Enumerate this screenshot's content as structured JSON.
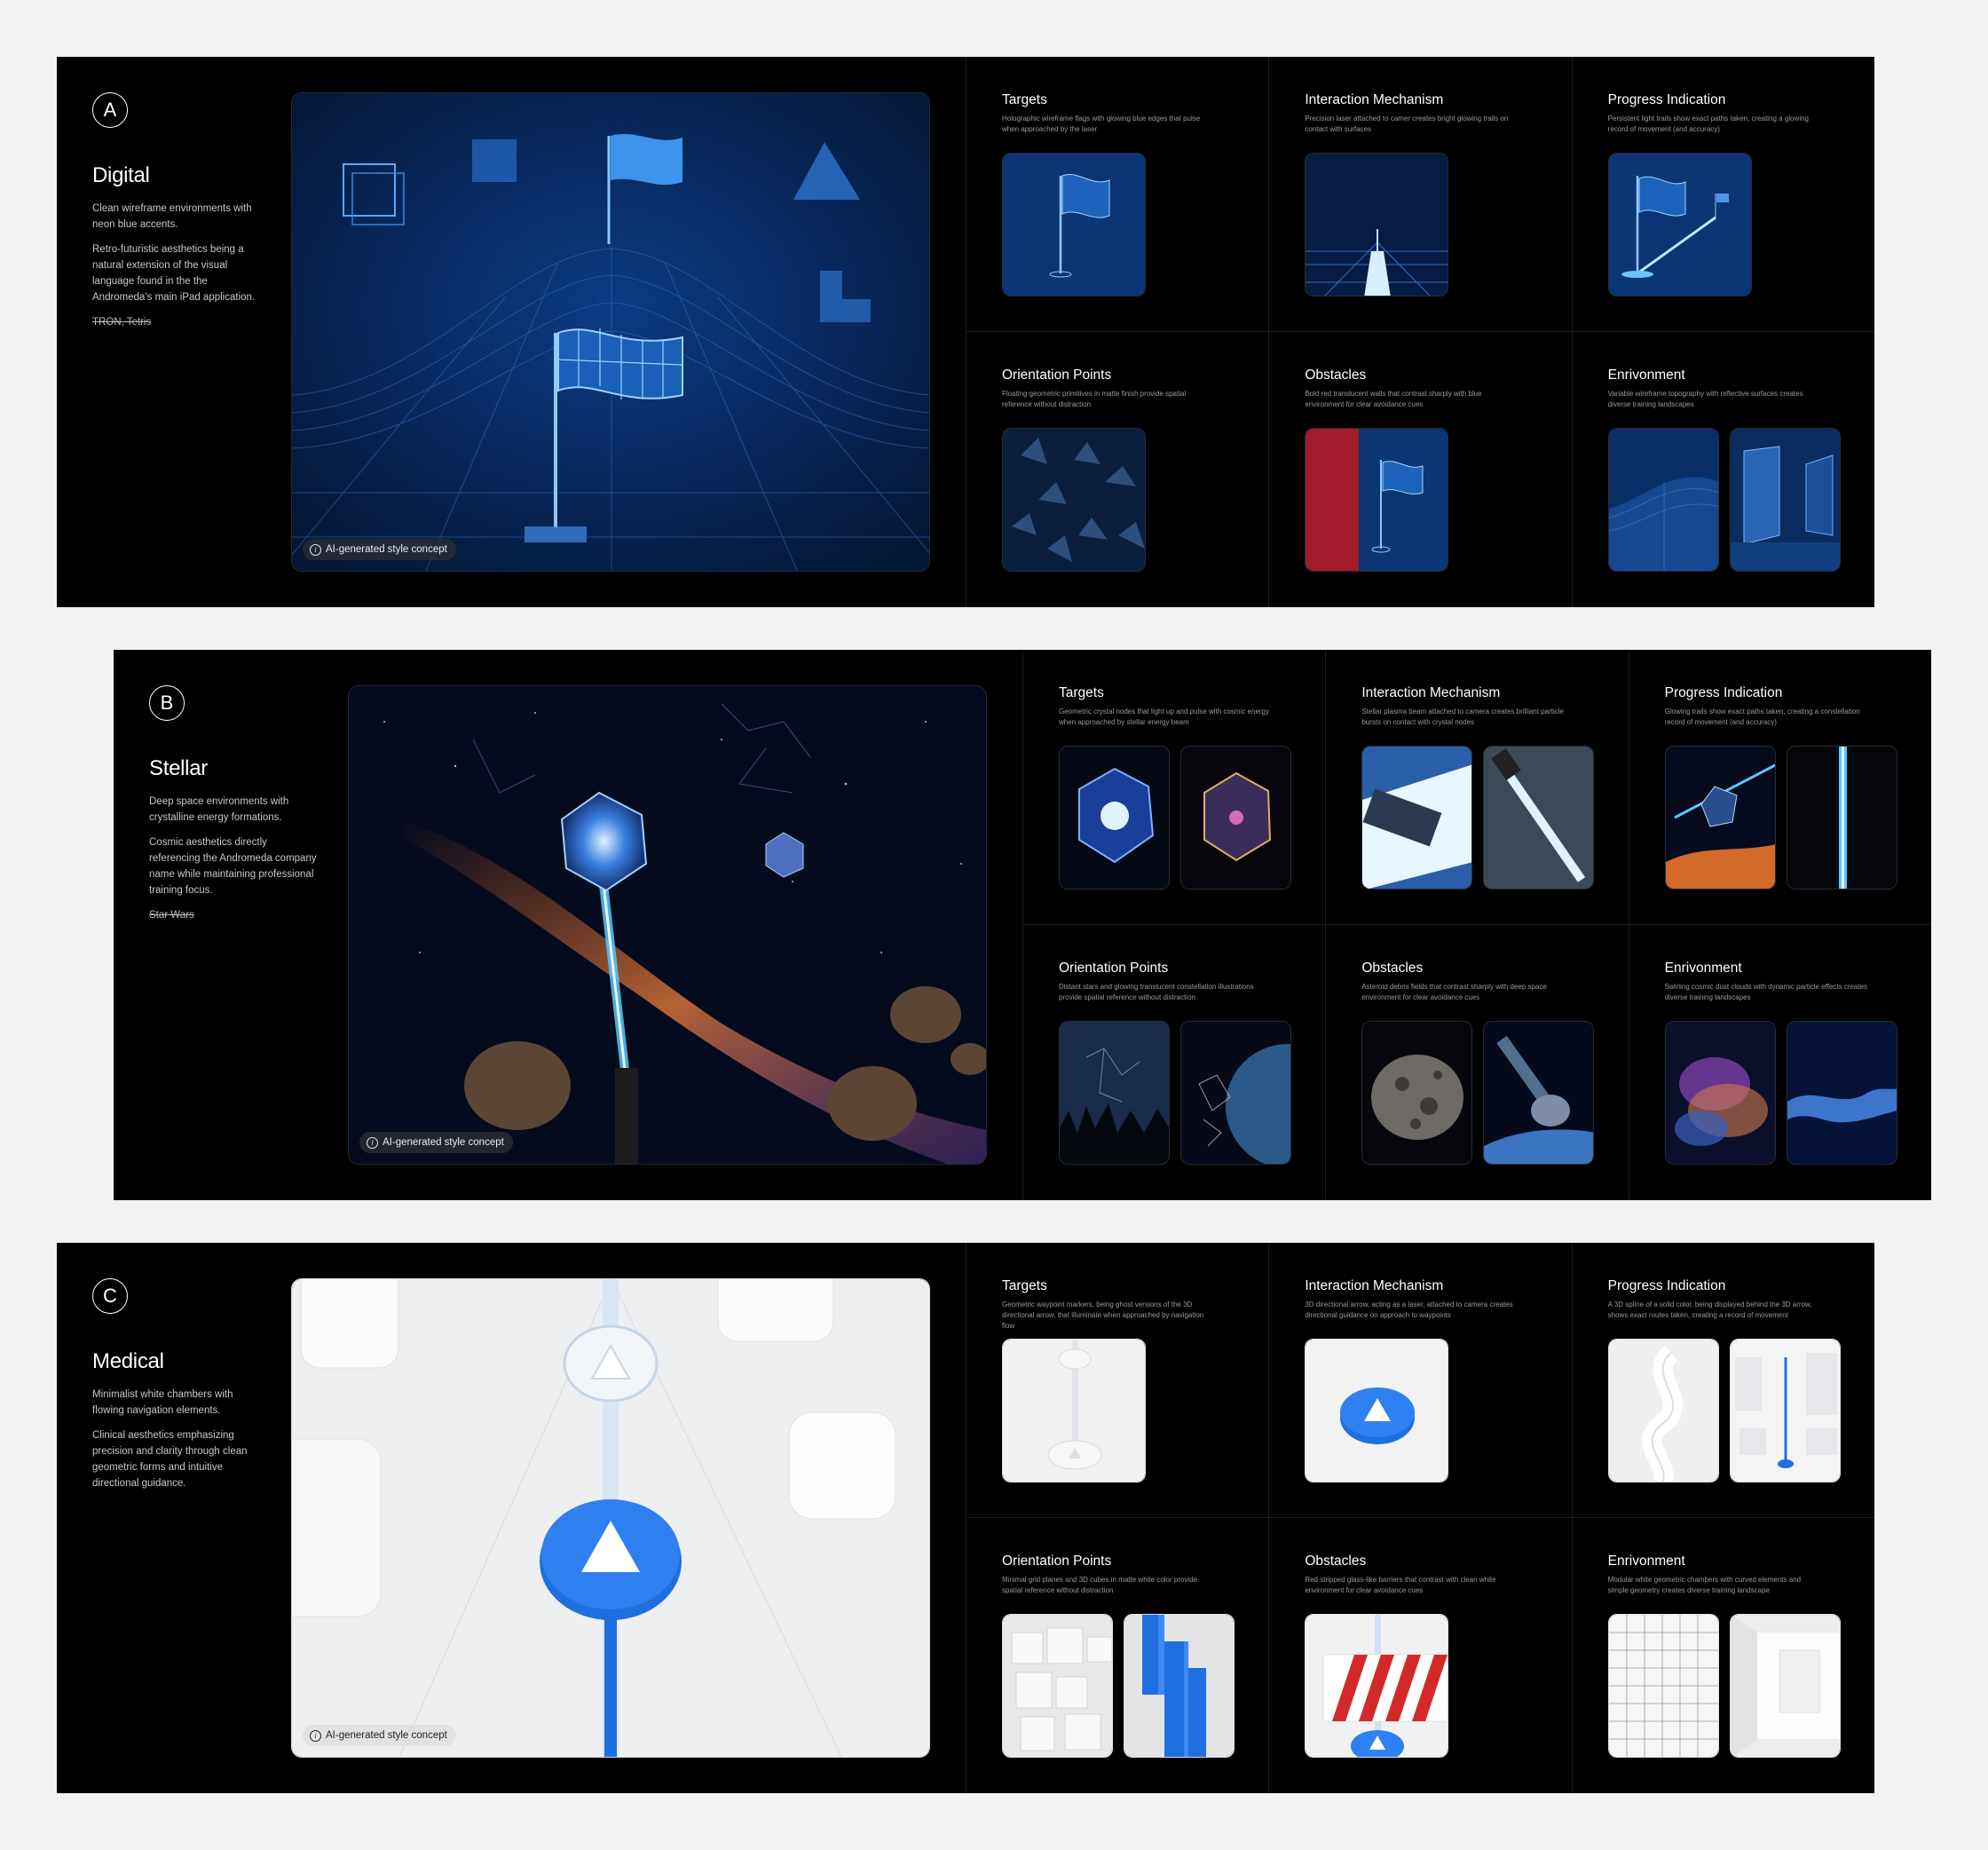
{
  "panels": [
    {
      "letter": "A",
      "title": "Digital",
      "desc1": "Clean wireframe environments with neon blue accents.",
      "desc2": "Retro-futuristic aesthetics being a natural extension of the visual language found in the the Andromeda's main iPad application.",
      "reference": "TRON, Tetris",
      "ai_label": "AI-generated style concept",
      "cells": [
        {
          "title": "Targets",
          "desc": "Holographic wireframe flags with glowing blue edges that pulse when approached by the laser"
        },
        {
          "title": "Interaction Mechanism",
          "desc": "Precision laser attached to camer creates bright glowing trails on contact with surfaces"
        },
        {
          "title": "Progress Indication",
          "desc": "Persistent light trails show exact paths taken, creating a glowing record of movement (and accuracy)"
        },
        {
          "title": "Orientation Points",
          "desc": "Floating geometric primitives in matte finish provide spatial reference without distraction"
        },
        {
          "title": "Obstacles",
          "desc": "Bold red translucent walls that contrast sharply with blue environment for clear avoidance cues"
        },
        {
          "title": "Enrivonment",
          "desc": "Variable wireframe topography with reflective surfaces creates diverse training landscapes"
        }
      ]
    },
    {
      "letter": "B",
      "title": "Stellar",
      "desc1": "Deep space environments with crystalline energy formations.",
      "desc2": "Cosmic aesthetics directly referencing the Andromeda company name while maintaining professional training focus.",
      "reference": "Star Wars",
      "ai_label": "AI-generated style concept",
      "cells": [
        {
          "title": "Targets",
          "desc": "Geometric crystal nodes that light up and pulse with cosmic energy when approached by stellar energy beam"
        },
        {
          "title": "Interaction Mechanism",
          "desc": "Stellar plasma beam attached to camera creates brilliant particle bursts on contact with crystal nodes"
        },
        {
          "title": "Progress Indication",
          "desc": "Glowing trails show exact paths taken, creating a constellation record of movement (and accuracy)"
        },
        {
          "title": "Orientation Points",
          "desc": "Distant stars and glowing translucent constellation illustrations provide spatial reference without distraction"
        },
        {
          "title": "Obstacles",
          "desc": "Asteroid debris fields that contrast sharply with deep space environment for clear avoidance cues"
        },
        {
          "title": "Enrivonment",
          "desc": "Swirling cosmic dust clouds with dynamic particle effects creates diverse training landscapes"
        }
      ]
    },
    {
      "letter": "C",
      "title": "Medical",
      "desc1": "Minimalist white chambers with flowing navigation elements.",
      "desc2": "Clinical aesthetics emphasizing precision and clarity through clean geometric forms and intuitive directional guidance.",
      "reference": "",
      "ai_label": "AI-generated style concept",
      "cells": [
        {
          "title": "Targets",
          "desc": "Geometric waypoint markers, being ghost versions of the 3D directional arrow, that illuminate when approached by navigation flow"
        },
        {
          "title": "Interaction Mechanism",
          "desc": "3D directional arrow, acting as a laser, attached to camera creates directional guidance on approach to waypoints"
        },
        {
          "title": "Progress Indication",
          "desc": "A 3D spline of a solid color, being displayed behind the 3D arrow, shows exact routes taken, creating a record of movement"
        },
        {
          "title": "Orientation Points",
          "desc": "Minimal grid planes and 3D cubes in matte white color provide spatial reference without distraction"
        },
        {
          "title": "Obstacles",
          "desc": "Red stripped glass-like barriers that contrast with clean white environment for clear avoidance cues"
        },
        {
          "title": "Enrivonment",
          "desc": "Modular white geometric chambers with curved elements and simple geometry creates diverse training landscape"
        }
      ]
    }
  ],
  "colors": {
    "accent_blue": "#1f6fe0",
    "neon_blue": "#4aa8ff",
    "obstacle_red": "#c0202c"
  },
  "icons": {
    "info": "info-icon"
  }
}
